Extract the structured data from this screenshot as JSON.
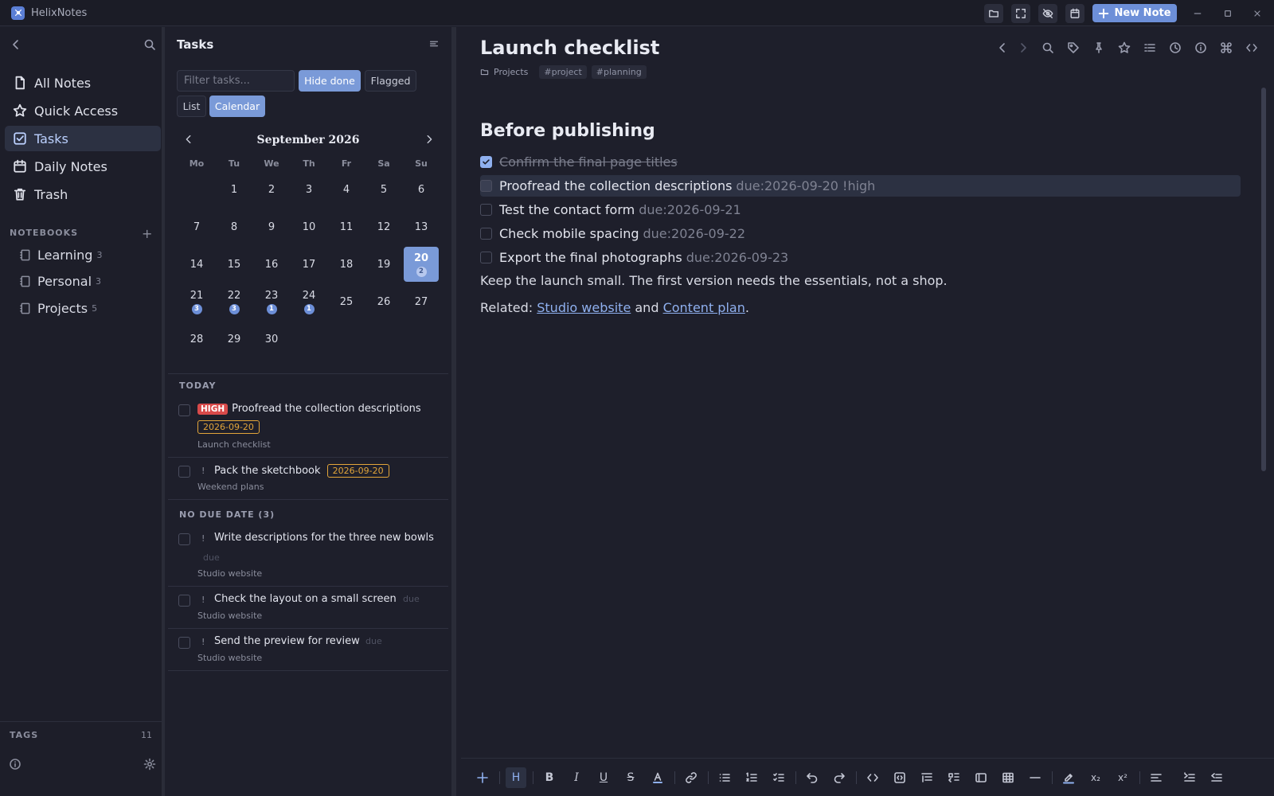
{
  "window": {
    "app_title": "HelixNotes",
    "new_note_label": "New Note"
  },
  "sidebar": {
    "nav": [
      {
        "label": "All Notes",
        "icon": "file-icon"
      },
      {
        "label": "Quick Access",
        "icon": "star-icon"
      },
      {
        "label": "Tasks",
        "icon": "check-square-icon",
        "active": true
      },
      {
        "label": "Daily Notes",
        "icon": "calendar-icon"
      },
      {
        "label": "Trash",
        "icon": "trash-icon"
      }
    ],
    "notebooks_header": "NOTEBOOKS",
    "notebooks": [
      {
        "label": "Learning",
        "count": "3"
      },
      {
        "label": "Personal",
        "count": "3"
      },
      {
        "label": "Projects",
        "count": "5"
      }
    ],
    "tags_header": "TAGS",
    "tags_count": "11"
  },
  "tasks": {
    "title": "Tasks",
    "filter_placeholder": "Filter tasks...",
    "hide_done_label": "Hide done",
    "flagged_label": "Flagged",
    "list_label": "List",
    "calendar_label": "Calendar",
    "calendar": {
      "month_label": "September 2026",
      "weekdays": [
        "Mo",
        "Tu",
        "We",
        "Th",
        "Fr",
        "Sa",
        "Su"
      ],
      "first_weekday_offset": 1,
      "days_in_month": 30,
      "today": 20,
      "task_counts": {
        "20": "2",
        "21": "3",
        "22": "3",
        "23": "1",
        "24": "1"
      }
    },
    "today_header": "TODAY",
    "today_items": [
      {
        "priority": "HIGH",
        "text": "Proofread the collection descriptions",
        "date": "2026-09-20",
        "source": "Launch checklist"
      },
      {
        "priority_mark": "!",
        "text": "Pack the sketchbook",
        "date": "2026-09-20",
        "source": "Weekend plans"
      }
    ],
    "no_due_header": "NO DUE DATE (3)",
    "no_due_items": [
      {
        "priority_mark": "!",
        "text": "Write descriptions for the three new bowls",
        "due_hint": "due",
        "source": "Studio website"
      },
      {
        "priority_mark": "!",
        "text": "Check the layout on a small screen",
        "due_hint": "due",
        "source": "Studio website"
      },
      {
        "priority_mark": "!",
        "text": "Send the preview for review",
        "due_hint": "due",
        "source": "Studio website"
      }
    ]
  },
  "editor": {
    "title": "Launch checklist",
    "breadcrumb_notebook": "Projects",
    "tags": [
      "#project",
      "#planning"
    ],
    "heading": "Before publishing",
    "todos": [
      {
        "text": "Confirm the final page titles",
        "meta": "",
        "done": true
      },
      {
        "text": "Proofread the collection descriptions",
        "meta": "due:2026-09-20 !high",
        "done": false,
        "highlighted": true
      },
      {
        "text": "Test the contact form",
        "meta": "due:2026-09-21",
        "done": false
      },
      {
        "text": "Check mobile spacing",
        "meta": "due:2026-09-22",
        "done": false
      },
      {
        "text": "Export the final photographs",
        "meta": "due:2026-09-23",
        "done": false
      }
    ],
    "paragraph": "Keep the launch small. The first version needs the essentials, not a shop.",
    "related_prefix": "Related:",
    "related_link_1": "Studio website",
    "related_and": "and",
    "related_link_2": "Content plan",
    "related_suffix": ".",
    "toolbar_icons": [
      "back-icon",
      "forward-icon",
      "search-icon",
      "tag-icon",
      "pin-icon",
      "star-icon",
      "outline-icon",
      "history-icon",
      "info-icon",
      "command-icon",
      "code-icon"
    ]
  },
  "format_bar": {
    "heading_glyph": "H",
    "bold_glyph": "B",
    "italic_glyph": "I",
    "underline_glyph": "U",
    "strike_glyph": "S",
    "sub_glyph": "x₂",
    "sup_glyph": "x²"
  },
  "colors": {
    "accent": "#7a9ad8",
    "high_priority": "#d84a4a",
    "date_chip": "#e2a53a",
    "link": "#8fb0ef"
  }
}
